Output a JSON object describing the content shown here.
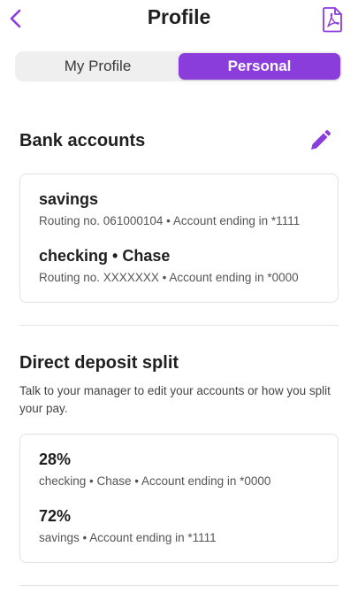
{
  "header": {
    "title": "Profile",
    "back_icon": "chevron-left-icon",
    "pdf_icon": "pdf-document-icon"
  },
  "tabs": [
    {
      "label": "My Profile",
      "active": false
    },
    {
      "label": "Personal",
      "active": true
    }
  ],
  "bank_accounts": {
    "title": "Bank accounts",
    "edit_icon": "pencil-icon",
    "accounts": [
      {
        "name": "savings",
        "detail": "Routing no. 061000104 • Account ending in *1111"
      },
      {
        "name": "checking • Chase",
        "detail": "Routing no. XXXXXXX • Account ending in *0000"
      }
    ]
  },
  "direct_deposit": {
    "title": "Direct deposit split",
    "note": "Talk to your manager to edit your accounts or how you split your pay.",
    "splits": [
      {
        "percent": "28%",
        "detail": "checking • Chase • Account ending in *0000"
      },
      {
        "percent": "72%",
        "detail": "savings • Account ending in *1111"
      }
    ]
  },
  "colors": {
    "accent": "#8a3ddb",
    "segment_bg": "#efefef",
    "border": "#e2e2e2"
  }
}
